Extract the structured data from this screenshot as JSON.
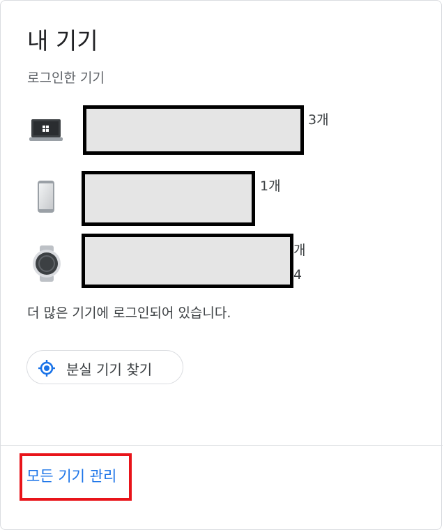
{
  "header": {
    "title": "내 기기",
    "subtitle": "로그인한 기기"
  },
  "devices": [
    {
      "type": "laptop-icon",
      "count": "3개"
    },
    {
      "type": "phone-icon",
      "count": "1개"
    },
    {
      "type": "watch-icon",
      "count_line1": "개",
      "count_line2": "4"
    }
  ],
  "more_text": "더 많은 기기에 로그인되어 있습니다.",
  "find_button": {
    "label": "분실 기기 찾기",
    "icon": "location-icon"
  },
  "footer": {
    "manage_label": "모든 기기 관리"
  },
  "colors": {
    "link": "#1a73e8",
    "accent": "#1a73e8",
    "highlight": "#e8141a"
  }
}
